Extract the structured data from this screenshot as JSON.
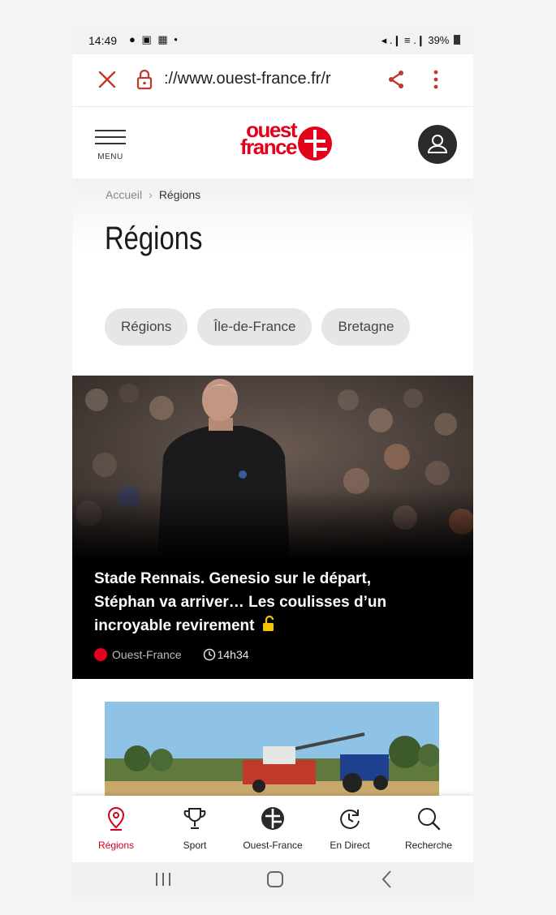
{
  "status_bar": {
    "time": "14:49",
    "notification_icons": "● ▣ ▦ •",
    "system_icons": "◂ .❙ ≡ .❙",
    "battery": "39%"
  },
  "browser": {
    "url": "://www.ouest-france.fr/r",
    "close_icon": "close-icon",
    "lock_icon": "lock-icon",
    "share_icon": "share-icon",
    "more_icon": "more-vertical-icon",
    "accent_color": "#c0392b"
  },
  "site_header": {
    "menu_label": "MENU",
    "logo_line1": "ouest",
    "logo_line2": "france",
    "brand_color": "#e2001a",
    "profile_icon": "user-icon"
  },
  "breadcrumb": {
    "home": "Accueil",
    "separator": "›",
    "current": "Régions"
  },
  "page": {
    "title": "Régions"
  },
  "chips": [
    "Régions",
    "Île-de-France",
    "Bretagne"
  ],
  "article": {
    "title": "Stade Rennais. Genesio sur le départ, Stéphan va arriver… Les coulisses d’un incroyable revirement",
    "source": "Ouest-France",
    "time": "14h34",
    "premium_icon": "unlock-icon",
    "premium_color": "#f5c400"
  },
  "bottom_nav": [
    {
      "label": "Régions",
      "icon": "location-pin-icon",
      "active": true
    },
    {
      "label": "Sport",
      "icon": "trophy-icon",
      "active": false
    },
    {
      "label": "Ouest-France",
      "icon": "ouest-france-logo-icon",
      "active": false
    },
    {
      "label": "En Direct",
      "icon": "live-clock-icon",
      "active": false
    },
    {
      "label": "Recherche",
      "icon": "search-icon",
      "active": false
    }
  ],
  "android_nav": {
    "recents_icon": "recents-icon",
    "home_icon": "home-icon",
    "back_icon": "back-icon"
  }
}
